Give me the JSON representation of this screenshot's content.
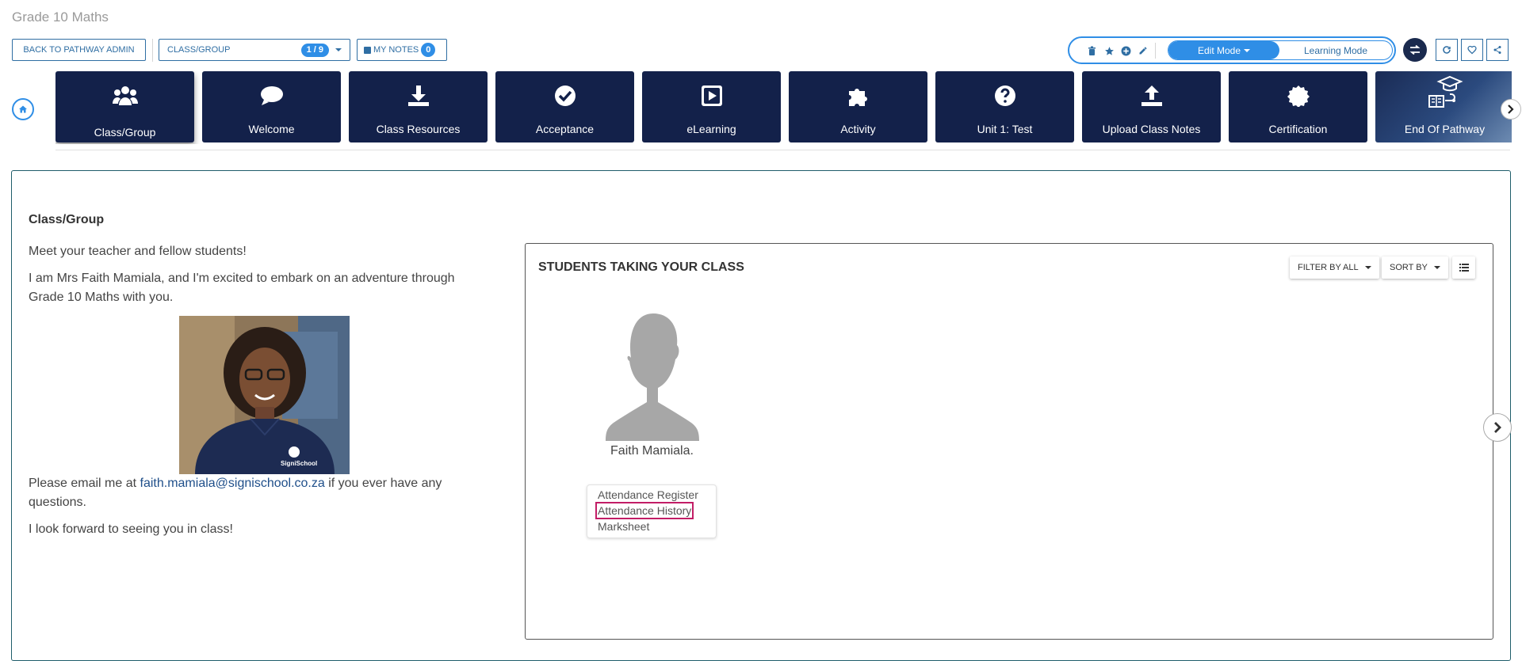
{
  "page": {
    "title": "Grade 10 Maths"
  },
  "toolbar": {
    "back_label": "BACK TO PATHWAY ADMIN",
    "class_group_label": "CLASS/GROUP",
    "class_group_count": "1 / 9",
    "my_notes_label": "MY NOTES",
    "my_notes_count": "0",
    "edit_mode_label": "Edit Mode",
    "learning_mode_label": "Learning Mode"
  },
  "nav_tiles": [
    {
      "label": "Class/Group",
      "icon": "users-icon",
      "active": true
    },
    {
      "label": "Welcome",
      "icon": "comment-icon"
    },
    {
      "label": "Class Resources",
      "icon": "download-icon"
    },
    {
      "label": "Acceptance",
      "icon": "check-circle-icon"
    },
    {
      "label": "eLearning",
      "icon": "play-square-icon"
    },
    {
      "label": "Activity",
      "icon": "puzzle-icon"
    },
    {
      "label": "Unit 1: Test",
      "icon": "question-circle-icon"
    },
    {
      "label": "Upload Class Notes",
      "icon": "upload-icon"
    },
    {
      "label": "Certification",
      "icon": "certificate-icon"
    },
    {
      "label": "End Of Pathway",
      "icon": "graduation-cap-icon"
    }
  ],
  "content": {
    "section_title": "Class/Group",
    "intro_1": "Meet your teacher and fellow students!",
    "intro_2": "I am Mrs Faith Mamiala, and I'm excited to embark on an adventure through Grade 10 Maths with you.",
    "email_prefix": "Please email me at ",
    "email": "faith.mamiala@signischool.co.za",
    "email_suffix": " if you ever have any questions.",
    "closing": "I look forward to seeing you in class!",
    "photo_logo": "SigniSchool"
  },
  "students": {
    "title": "STUDENTS TAKING YOUR CLASS",
    "filter_label": "FILTER BY ALL",
    "sort_label": "SORT BY",
    "student_name": "Faith Mamiala.",
    "menu": [
      "Attendance Register",
      "Attendance History",
      "Marksheet"
    ]
  },
  "colors": {
    "navy": "#13214a",
    "accent": "#2f8ee6",
    "link": "#1f4f8a",
    "highlight": "#c21d66"
  }
}
